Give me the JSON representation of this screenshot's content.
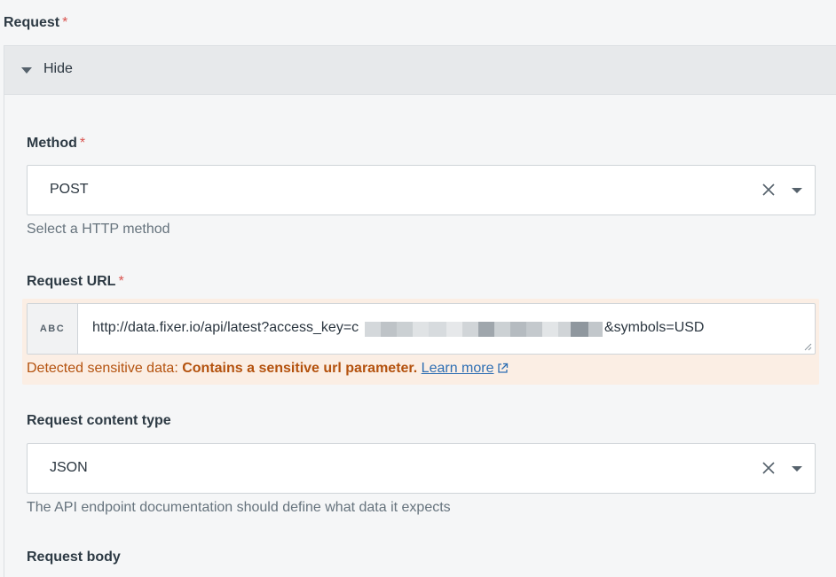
{
  "request": {
    "label": "Request",
    "required_mark": "*"
  },
  "toggle": {
    "label": "Hide"
  },
  "method": {
    "label": "Method",
    "required_mark": "*",
    "value": "POST",
    "help": "Select a HTTP method"
  },
  "url": {
    "label": "Request URL",
    "required_mark": "*",
    "type_badge": "ABC",
    "value_visible": "http://data.fixer.io/api/latest?access_key=c",
    "value_suffix": "&symbols=USD"
  },
  "warning": {
    "prefix": "Detected sensitive data: ",
    "message": "Contains a sensitive url parameter.",
    "link": "Learn more"
  },
  "content_type": {
    "label": "Request content type",
    "value": "JSON",
    "help": "The API endpoint documentation should define what data it expects"
  },
  "body": {
    "label": "Request body"
  },
  "colors": {
    "warning_text": "#b4520e",
    "warning_bg": "#fbeee4",
    "required": "#d9534f",
    "link": "#2f6fb3"
  }
}
